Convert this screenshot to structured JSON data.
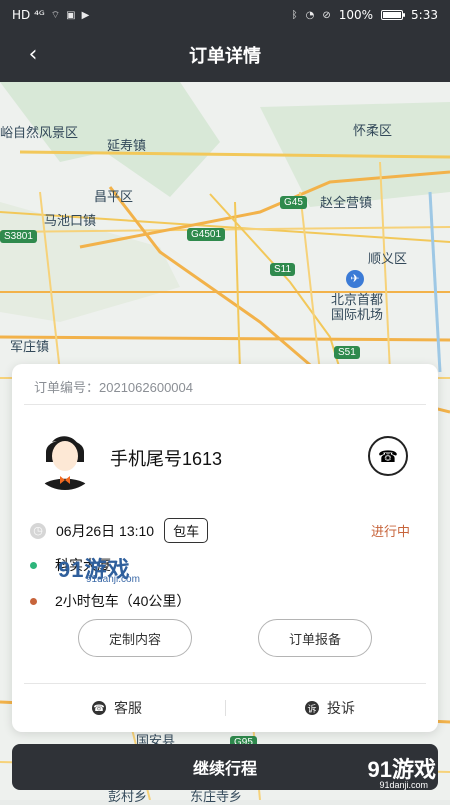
{
  "status_bar": {
    "left": "HD ⁴ᴳ",
    "battery": "100%",
    "time": "5:33"
  },
  "header": {
    "title": "订单详情",
    "back_icon": "chevron-left-icon"
  },
  "map": {
    "labels": [
      "峪自然风景区",
      "延寿镇",
      "怀柔区",
      "昌平区",
      "赵全营镇",
      "马池口镇",
      "顺义区",
      "北京首都",
      "国际机场",
      "军庄镇",
      "国安县",
      "彭村乡",
      "东庄寺乡"
    ],
    "shields": [
      "G45",
      "G4501",
      "S3801",
      "S11",
      "S51",
      "G95"
    ]
  },
  "card": {
    "order_number": "订单编号：2021062600004",
    "phone_suffix": "手机尾号1613",
    "time": "06月26日 13:10",
    "type_chip": "包车",
    "status": "进行中",
    "pickup": "科实大厦",
    "duration": "2小时包车（40公里）",
    "custom_button": "定制内容",
    "report_button": "订单报备",
    "customer_service": "客服",
    "complaint": "投诉",
    "status_color": "#c7643b"
  },
  "footer": {
    "continue_button": "继续行程"
  },
  "watermark": {
    "main": "91游戏",
    "sub": "91danji.com"
  },
  "colors": {
    "header_bg": "#2f3237",
    "accent": "#c7643b",
    "pickup_dot": "#2db57b"
  }
}
